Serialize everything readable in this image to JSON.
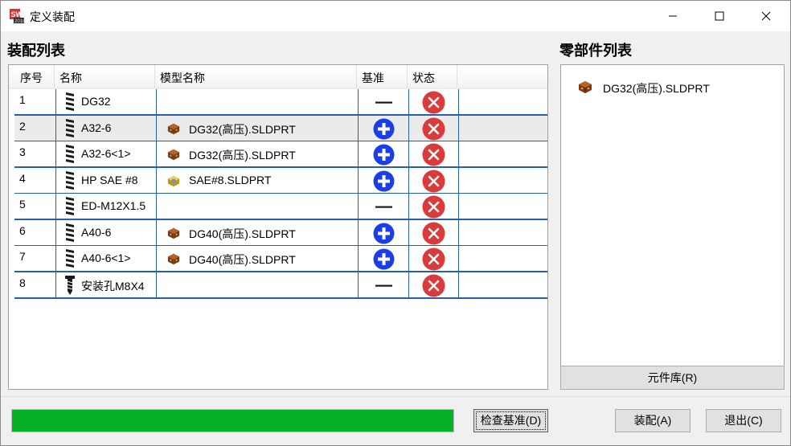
{
  "window": {
    "title": "定义装配",
    "app_icon": "solidworks-2018-icon",
    "controls": [
      "minimize-icon",
      "maximize-icon",
      "close-icon"
    ]
  },
  "assembly_list": {
    "title": "装配列表",
    "columns": [
      "序号",
      "名称",
      "模型名称",
      "基准",
      "状态"
    ],
    "rows": [
      {
        "no": "1",
        "name": "DG32",
        "name_icon": "thread-icon",
        "model": "",
        "model_icon": "",
        "base": "minus-icon",
        "state": "error-x-icon"
      },
      {
        "no": "2",
        "name": "A32-6",
        "name_icon": "thread-icon",
        "model": "DG32(高压).SLDPRT",
        "model_icon": "part-brown-icon",
        "base": "plus-circle-icon",
        "state": "error-x-icon"
      },
      {
        "no": "3",
        "name": "A32-6<1>",
        "name_icon": "thread-icon",
        "model": "DG32(高压).SLDPRT",
        "model_icon": "part-brown-icon",
        "base": "plus-circle-icon",
        "state": "error-x-icon"
      },
      {
        "no": "4",
        "name": "HP SAE #8",
        "name_icon": "thread-icon",
        "model": "SAE#8.SLDPRT",
        "model_icon": "part-yellow-icon",
        "base": "plus-circle-icon",
        "state": "error-x-icon"
      },
      {
        "no": "5",
        "name": "ED-M12X1.5",
        "name_icon": "thread-icon",
        "model": "",
        "model_icon": "",
        "base": "minus-icon",
        "state": "error-x-icon"
      },
      {
        "no": "6",
        "name": "A40-6",
        "name_icon": "thread-icon",
        "model": "DG40(高压).SLDPRT",
        "model_icon": "part-brown-icon",
        "base": "plus-circle-icon",
        "state": "error-x-icon"
      },
      {
        "no": "7",
        "name": "A40-6<1>",
        "name_icon": "thread-icon",
        "model": "DG40(高压).SLDPRT",
        "model_icon": "part-brown-icon",
        "base": "plus-circle-icon",
        "state": "error-x-icon"
      },
      {
        "no": "8",
        "name": "安装孔M8X4",
        "name_icon": "screw-icon",
        "model": "",
        "model_icon": "",
        "base": "minus-icon",
        "state": "error-x-icon"
      }
    ],
    "selected_row": 2
  },
  "parts_list": {
    "title": "零部件列表",
    "items": [
      {
        "label": "DG32(高压).SLDPRT",
        "icon": "part-brown-icon"
      }
    ],
    "library_button": "元件库(R)"
  },
  "footer": {
    "progress_fraction": 1.0,
    "check_button": "检查基准(D)",
    "assemble_button": "装配(A)",
    "exit_button": "退出(C)"
  },
  "colors": {
    "grid_line": "#2a5ea8",
    "plus_blue": "#1a3ee8",
    "error_red": "#d93a3a",
    "progress_green": "#06b025"
  }
}
